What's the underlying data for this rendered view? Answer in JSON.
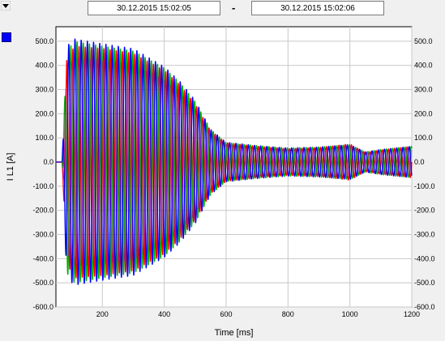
{
  "header": {
    "date_from": "30.12.2015     15:02:05",
    "separator": "-",
    "date_to": "30.12.2015     15:02:06"
  },
  "icons": {
    "menu": "dropdown-arrow-icon"
  },
  "colors": {
    "swatch": "#0000ff",
    "red": "#ff0000",
    "green": "#00b000",
    "blue": "#0000ff",
    "magenta": "#c0008c"
  },
  "chart_data": {
    "type": "line",
    "xlabel": "Time [ms]",
    "ylabel": "I L1 [A]",
    "xlim": [
      50,
      1200
    ],
    "ylim": [
      -600,
      560
    ],
    "x_ticks": [
      "200",
      "400",
      "600",
      "800",
      "1000",
      "1200"
    ],
    "y_ticks": [
      "-600.0",
      "-500.0",
      "-400.0",
      "-300.0",
      "-200.0",
      "-100.0",
      "0.0",
      "100.0",
      "200.0",
      "300.0",
      "400.0",
      "500.0"
    ],
    "grid": true,
    "frequency_hz": 50,
    "series": [
      {
        "color": "red",
        "envelope": [
          [
            50,
            0
          ],
          [
            70,
            0
          ],
          [
            85,
            420
          ],
          [
            110,
            480
          ],
          [
            200,
            470
          ],
          [
            300,
            450
          ],
          [
            400,
            380
          ],
          [
            450,
            320
          ],
          [
            500,
            240
          ],
          [
            550,
            130
          ],
          [
            600,
            80
          ],
          [
            700,
            65
          ],
          [
            800,
            55
          ],
          [
            900,
            60
          ],
          [
            1000,
            75
          ],
          [
            1050,
            40
          ],
          [
            1100,
            50
          ],
          [
            1200,
            65
          ]
        ]
      },
      {
        "color": "green",
        "envelope": [
          [
            50,
            0
          ],
          [
            70,
            0
          ],
          [
            85,
            460
          ],
          [
            110,
            500
          ],
          [
            200,
            480
          ],
          [
            300,
            460
          ],
          [
            400,
            390
          ],
          [
            450,
            330
          ],
          [
            500,
            250
          ],
          [
            550,
            135
          ],
          [
            600,
            80
          ],
          [
            700,
            68
          ],
          [
            800,
            58
          ],
          [
            900,
            62
          ],
          [
            1000,
            72
          ],
          [
            1050,
            42
          ],
          [
            1100,
            52
          ],
          [
            1200,
            65
          ]
        ]
      },
      {
        "color": "blue",
        "envelope": [
          [
            50,
            0
          ],
          [
            70,
            0
          ],
          [
            85,
            480
          ],
          [
            110,
            510
          ],
          [
            200,
            490
          ],
          [
            300,
            470
          ],
          [
            400,
            395
          ],
          [
            450,
            335
          ],
          [
            500,
            255
          ],
          [
            550,
            135
          ],
          [
            600,
            82
          ],
          [
            700,
            68
          ],
          [
            800,
            58
          ],
          [
            900,
            62
          ],
          [
            1000,
            72
          ],
          [
            1050,
            42
          ],
          [
            1100,
            52
          ],
          [
            1200,
            65
          ]
        ]
      }
    ]
  }
}
